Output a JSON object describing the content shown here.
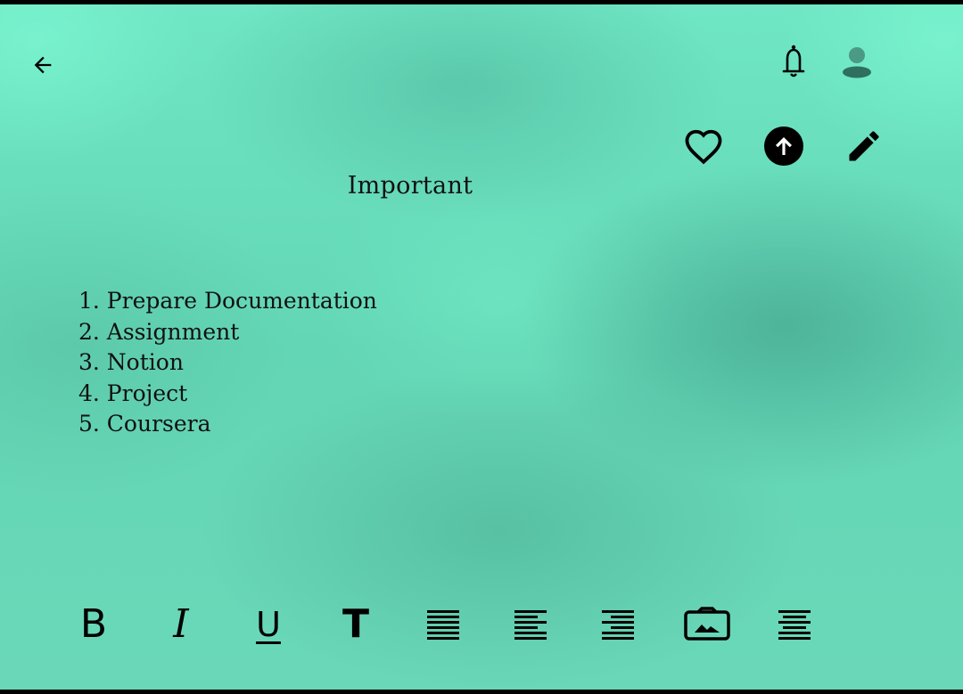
{
  "header": {
    "back_icon": "arrow-left-icon",
    "notification_icon": "bell-icon",
    "profile_icon": "user-avatar-icon"
  },
  "actions": {
    "favorite_icon": "heart-outline-icon",
    "upload_icon": "arrow-up-circle-icon",
    "edit_icon": "pencil-icon"
  },
  "note": {
    "title": "Important",
    "items": [
      "1. Prepare Documentation",
      "2. Assignment",
      "3. Notion",
      "4. Project",
      "5. Coursera"
    ]
  },
  "toolbar": {
    "bold_label": "B",
    "italic_label": "I",
    "underline_label": "U",
    "text_size_label": "T",
    "icons": [
      "bold-icon",
      "italic-icon",
      "underline-icon",
      "text-size-icon",
      "align-justify-icon",
      "align-left-icon",
      "align-right-icon",
      "insert-image-icon",
      "align-center-icon"
    ]
  },
  "colors": {
    "background": "#66dcbb",
    "foreground": "#000000",
    "avatar": "#3f7d6e"
  }
}
